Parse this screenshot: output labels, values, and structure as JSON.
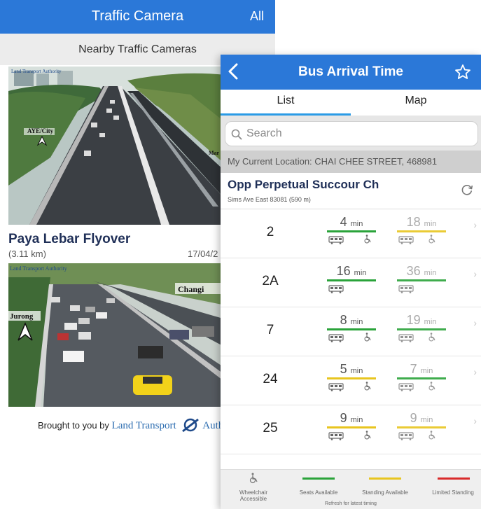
{
  "traffic": {
    "title": "Traffic Camera",
    "all_label": "All",
    "section": "Nearby Traffic Cameras",
    "camera1": {
      "overlay_label": "AYE/City",
      "edge_label": "Mar",
      "watermark": "Land Transport Authority"
    },
    "camera2": {
      "title": "Paya Lebar Flyover",
      "distance": "(3.11 km)",
      "date": "17/04/2",
      "overlay_left": "Jurong",
      "overlay_right": "Changi",
      "watermark": "Land Transport Authority"
    },
    "brought_prefix": "Brought to you by",
    "brought_org": "Land Transport",
    "brought_org_tail": "Authi"
  },
  "bus": {
    "title": "Bus Arrival Time",
    "tabs": [
      "List",
      "Map"
    ],
    "search_placeholder": "Search",
    "location": "My Current Location: CHAI CHEE STREET, 468981",
    "stop_name": "Opp Perpetual Succour Ch",
    "stop_sub": "Sims Ave East  83081 (590 m)",
    "services": [
      {
        "no": "2",
        "first": "4",
        "first_color": "#2aa33a",
        "second": "18",
        "second_color": "#e8c51f"
      },
      {
        "no": "2A",
        "first": "16",
        "first_color": "#2aa33a",
        "second": "36",
        "second_color": "#2aa33a"
      },
      {
        "no": "7",
        "first": "8",
        "first_color": "#2aa33a",
        "second": "19",
        "second_color": "#2aa33a"
      },
      {
        "no": "24",
        "first": "5",
        "first_color": "#e8c51f",
        "second": "7",
        "second_color": "#2aa33a"
      },
      {
        "no": "25",
        "first": "9",
        "first_color": "#e8c51f",
        "second": "9",
        "second_color": "#e8c51f"
      }
    ],
    "min_unit": "min",
    "legend": {
      "wheelchair": "Wheelchair Accessible",
      "seats": "Seats Available",
      "standing": "Standing Available",
      "limited": "Limited Standing",
      "footer": "Refresh for latest timing"
    },
    "colors": {
      "green": "#2aa33a",
      "yellow": "#e8c51f",
      "red": "#d92b2b",
      "nav": "#2b78d8"
    }
  }
}
